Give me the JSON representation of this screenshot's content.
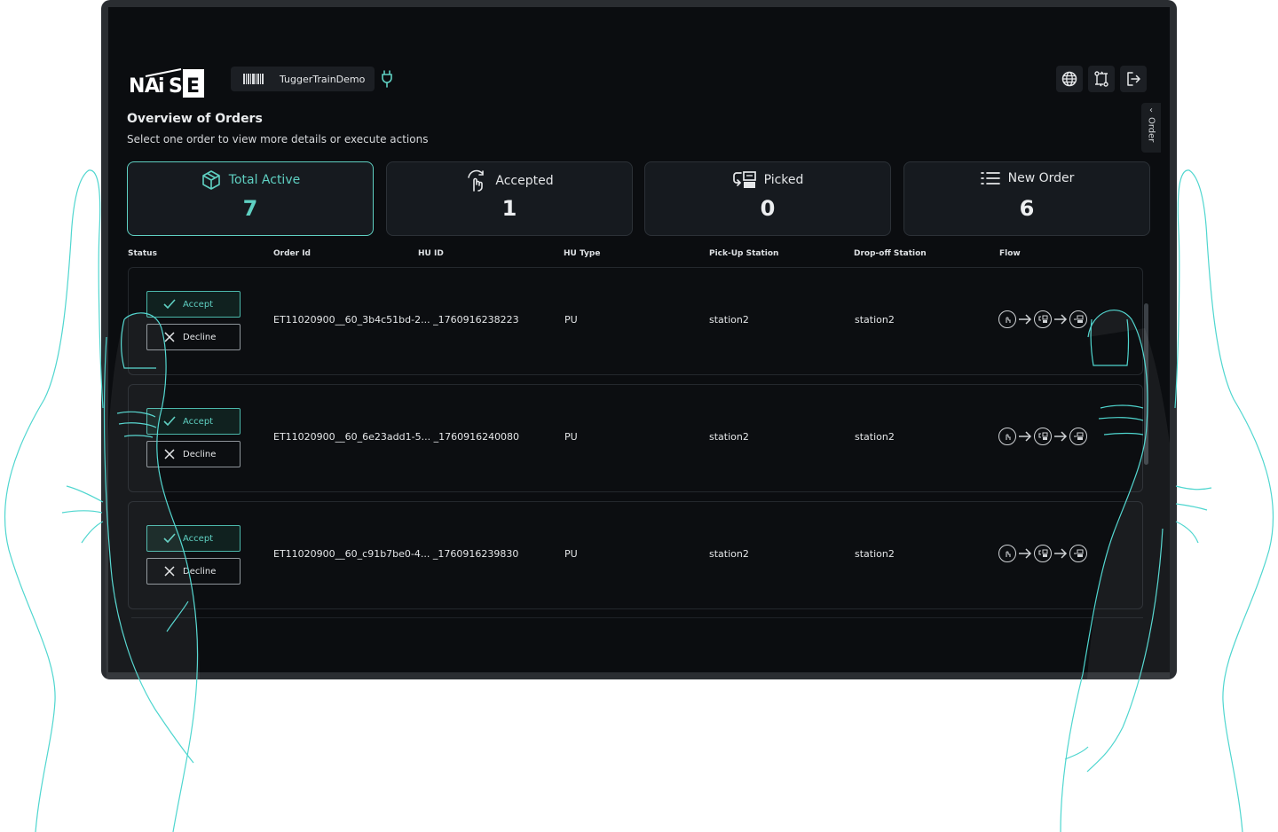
{
  "header": {
    "brand": "NAiSE",
    "device_name": "TuggerTrainDemo",
    "page_title": "Overview of Orders",
    "page_subtitle": "Select one order to view more details or execute actions",
    "side_tab_label": "Order"
  },
  "cards": [
    {
      "label": "Total Active",
      "value": "7",
      "icon": "cube-icon",
      "active": true
    },
    {
      "label": "Accepted",
      "value": "1",
      "icon": "hand-pointer-icon",
      "active": false
    },
    {
      "label": "Picked",
      "value": "0",
      "icon": "picked-icon",
      "active": false
    },
    {
      "label": "New Order",
      "value": "6",
      "icon": "list-icon",
      "active": false
    }
  ],
  "table": {
    "columns": [
      "Status",
      "Order Id",
      "HU ID",
      "HU Type",
      "Pick-Up Station",
      "Drop-off Station",
      "Flow"
    ],
    "accept_label": "Accept",
    "decline_label": "Decline",
    "rows": [
      {
        "order_id": "ET11020900__60_3b4c51bd-2... _1760916238223",
        "hu_type": "PU",
        "pickup": "station2",
        "dropoff": "station2"
      },
      {
        "order_id": "ET11020900__60_6e23add1-5... _1760916240080",
        "hu_type": "PU",
        "pickup": "station2",
        "dropoff": "station2"
      },
      {
        "order_id": "ET11020900__60_c91b7be0-4... _1760916239830",
        "hu_type": "PU",
        "pickup": "station2",
        "dropoff": "station2"
      }
    ]
  },
  "colors": {
    "accent": "#5fd0c2",
    "background": "#0b0d10",
    "card": "#161a1f"
  }
}
